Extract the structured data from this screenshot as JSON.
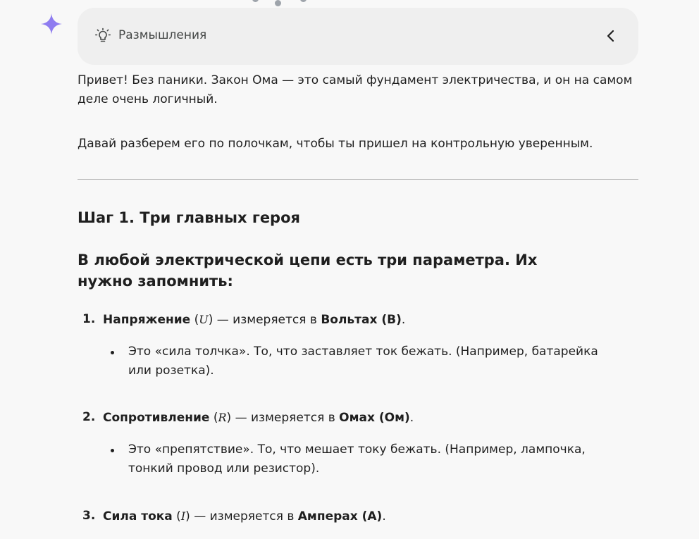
{
  "thinking": {
    "label": "Размышления"
  },
  "intro": {
    "p1": "Привет! Без паники. Закон Ома — это самый фундамент электричества, и он на самом деле очень логичный.",
    "p2": "Давай разберем его по полочкам, чтобы ты пришел на контрольную уверенным."
  },
  "step1": {
    "heading": "Шаг 1. Три главных героя",
    "subheading": "В любой электрической цепи есть три параметра. Их нужно запомнить:",
    "items": [
      {
        "num": "1.",
        "term": "Напряжение",
        "var": "U",
        "mid": " — измеряется в ",
        "unit": "Вольтах (В)",
        "bullet": "Это «сила толчка». То, что заставляет ток бежать. (Например, батарейка или розетка)."
      },
      {
        "num": "2.",
        "term": "Сопротивление",
        "var": "R",
        "mid": " — измеряется в ",
        "unit": "Омах (Ом)",
        "bullet": "Это «препятствие». То, что мешает току бежать. (Например, лампочка, тонкий провод или резистор)."
      },
      {
        "num": "3.",
        "term": "Сила тока",
        "var": "I",
        "mid": " — измеряется в ",
        "unit": "Амперах (А)"
      }
    ]
  },
  "colors": {
    "sparkle": "#8e7cf0",
    "thinking_bg": "#efefef",
    "text": "#1f1f1f"
  },
  "icons": {
    "assistant": "sparkle-icon",
    "thinking": "lightbulb-icon",
    "collapse": "chevron-left-icon"
  }
}
